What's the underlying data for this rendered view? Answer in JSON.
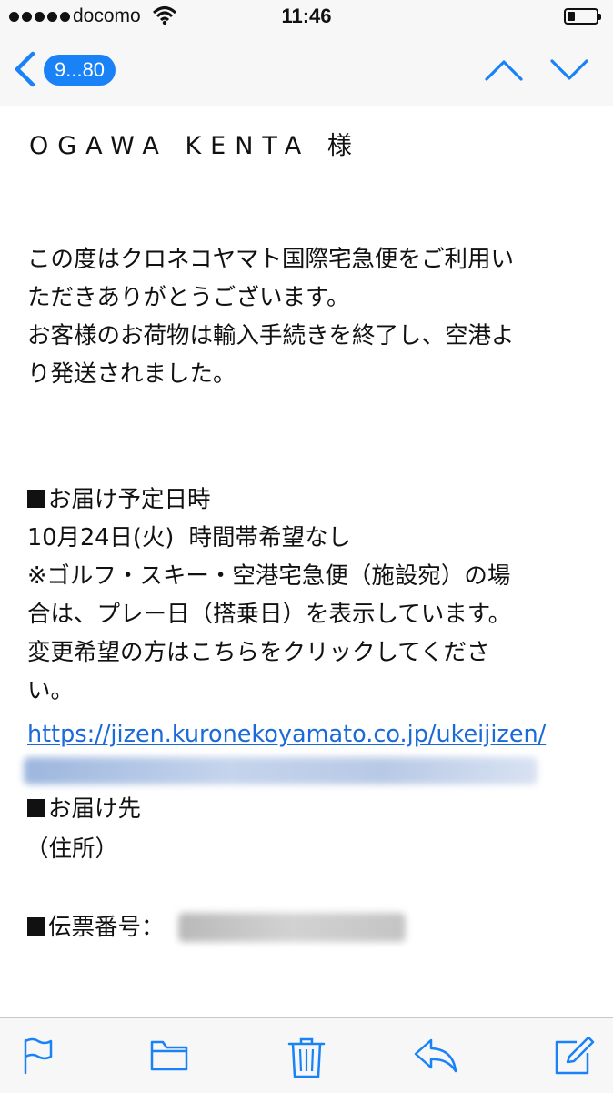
{
  "status_bar": {
    "carrier": "docomo",
    "time": "11:46"
  },
  "nav": {
    "pill_label": "9...80",
    "back_icon": "chevron-left-icon",
    "prev_icon": "chevron-up-icon",
    "next_icon": "chevron-down-icon",
    "accent_color": "#1a82f7"
  },
  "email": {
    "recipient": "OGAWA KENTA 様",
    "intro_lines": [
      "この度はクロネコヤマト国際宅急便をご利用い",
      "ただきありがとうございます。",
      "お客様のお荷物は輸入手続きを終了し、空港よ",
      "り発送されました。"
    ],
    "delivery_heading": "お届け予定日時",
    "delivery_lines": [
      "10月24日(火)  時間帯希望なし",
      "※ゴルフ・スキー・空港宅急便（施設宛）の場",
      "合は、プレー日（搭乗日）を表示しています。",
      "変更希望の方はこちらをクリックしてくださ",
      "い。"
    ],
    "link_text": "https://jizen.kuronekoyamato.co.jp/ukeijizen/",
    "destination_heading": "お届け先",
    "address_text": "（住所）",
    "slip_heading": "伝票番号："
  },
  "toolbar": {
    "icons": [
      "flag-icon",
      "folder-icon",
      "trash-icon",
      "reply-icon",
      "compose-icon"
    ],
    "icon_color": "#1a82f7"
  }
}
